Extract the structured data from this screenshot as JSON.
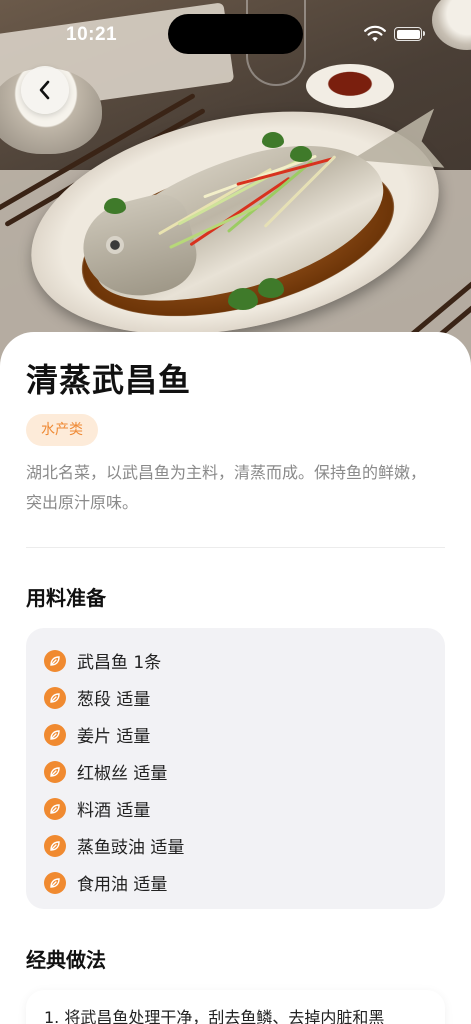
{
  "status_bar": {
    "time": "10:21",
    "icons": [
      "wifi-icon",
      "battery-icon"
    ]
  },
  "nav": {
    "back_icon": "chevron-left-icon"
  },
  "recipe": {
    "title": "清蒸武昌鱼",
    "category_tag": "水产类",
    "description": "湖北名菜，以武昌鱼为主料，清蒸而成。保持鱼的鲜嫩，突出原汁原味。"
  },
  "ingredients_section": {
    "heading": "用料准备",
    "icon": "leaf-icon",
    "items": [
      {
        "label": "武昌鱼 1条"
      },
      {
        "label": "葱段 适量"
      },
      {
        "label": "姜片 适量"
      },
      {
        "label": "红椒丝 适量"
      },
      {
        "label": "料酒 适量"
      },
      {
        "label": "蒸鱼豉油 适量"
      },
      {
        "label": "食用油 适量"
      }
    ]
  },
  "method_section": {
    "heading": "经典做法",
    "steps": [
      {
        "text": "1. 将武昌鱼处理干净，刮去鱼鳞、去掉内脏和黑"
      }
    ]
  },
  "colors": {
    "accent": "#f08a30",
    "tag_bg": "#fdebd9",
    "card_bg": "#f2f2f5"
  }
}
